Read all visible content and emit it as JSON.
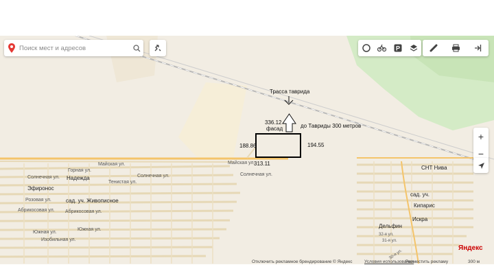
{
  "search": {
    "placeholder": "Поиск мест и адресов"
  },
  "toolbar": {
    "left_icons": [
      "layers-circle-icon",
      "bike-icon",
      "parking-icon",
      "layers-icon"
    ],
    "right_icons": [
      "ruler-icon",
      "print-icon",
      "exit-icon"
    ]
  },
  "map_labels": {
    "maiskaya_1": "Майская ул.",
    "maiskaya_2": "Майская ул.",
    "gornaya": "Горная ул.",
    "solnechnaya_1": "Солнечная ул.",
    "solnechnaya_2": "Солнечная ул.",
    "solnechnaya_3": "Солнечная ул.",
    "tenistaya": "Тенистая ул.",
    "nadezhda": "Надежда",
    "efironos": "Эфиронос",
    "rozovaya": "Розовая ул.",
    "zhivopisnoe": "сад. уч. Живописное",
    "abrikosovaya_1": "Абрикосовая ул.",
    "abrikosovaya_2": "Абрикосовая ул.",
    "yuzhnaya_1": "Южная ул.",
    "yuzhnaya_2": "Южная ул.",
    "izobilnaya": "Изобильная ул.",
    "snt_niva": "СНТ Нива",
    "sad_uch": "сад. уч.",
    "kiparis": "Кипарис",
    "iskra": "Искра",
    "delfin": "Дельфин",
    "st32": "32-я ул.",
    "st31": "31-я ул.",
    "st30": "30-я ул."
  },
  "annotations": {
    "highway": "Трасса таврида",
    "distance": "до Тавриды 300 метров",
    "top_side": "336.12",
    "facade": "фасад",
    "left_side": "188.86",
    "right_side": "194.55",
    "bottom_side": "313.11"
  },
  "bottom": {
    "ad_disable": "Отключить рекламное брендирование",
    "copyright": "© Яндекс",
    "terms": "Условия использования",
    "ad": "Разместить рекламу",
    "scale": "300 м"
  },
  "brand": "Яндекс",
  "zoom": {
    "plus": "+",
    "minus": "−"
  },
  "colors": {
    "map_bg": "#f2ede3",
    "road_major": "#f4c46a",
    "road_minor": "#e7d9b8",
    "green": "#cfe8c0",
    "railway": "#b9b9b9",
    "annotation": "#000000",
    "brand_red": "#cc0000"
  }
}
